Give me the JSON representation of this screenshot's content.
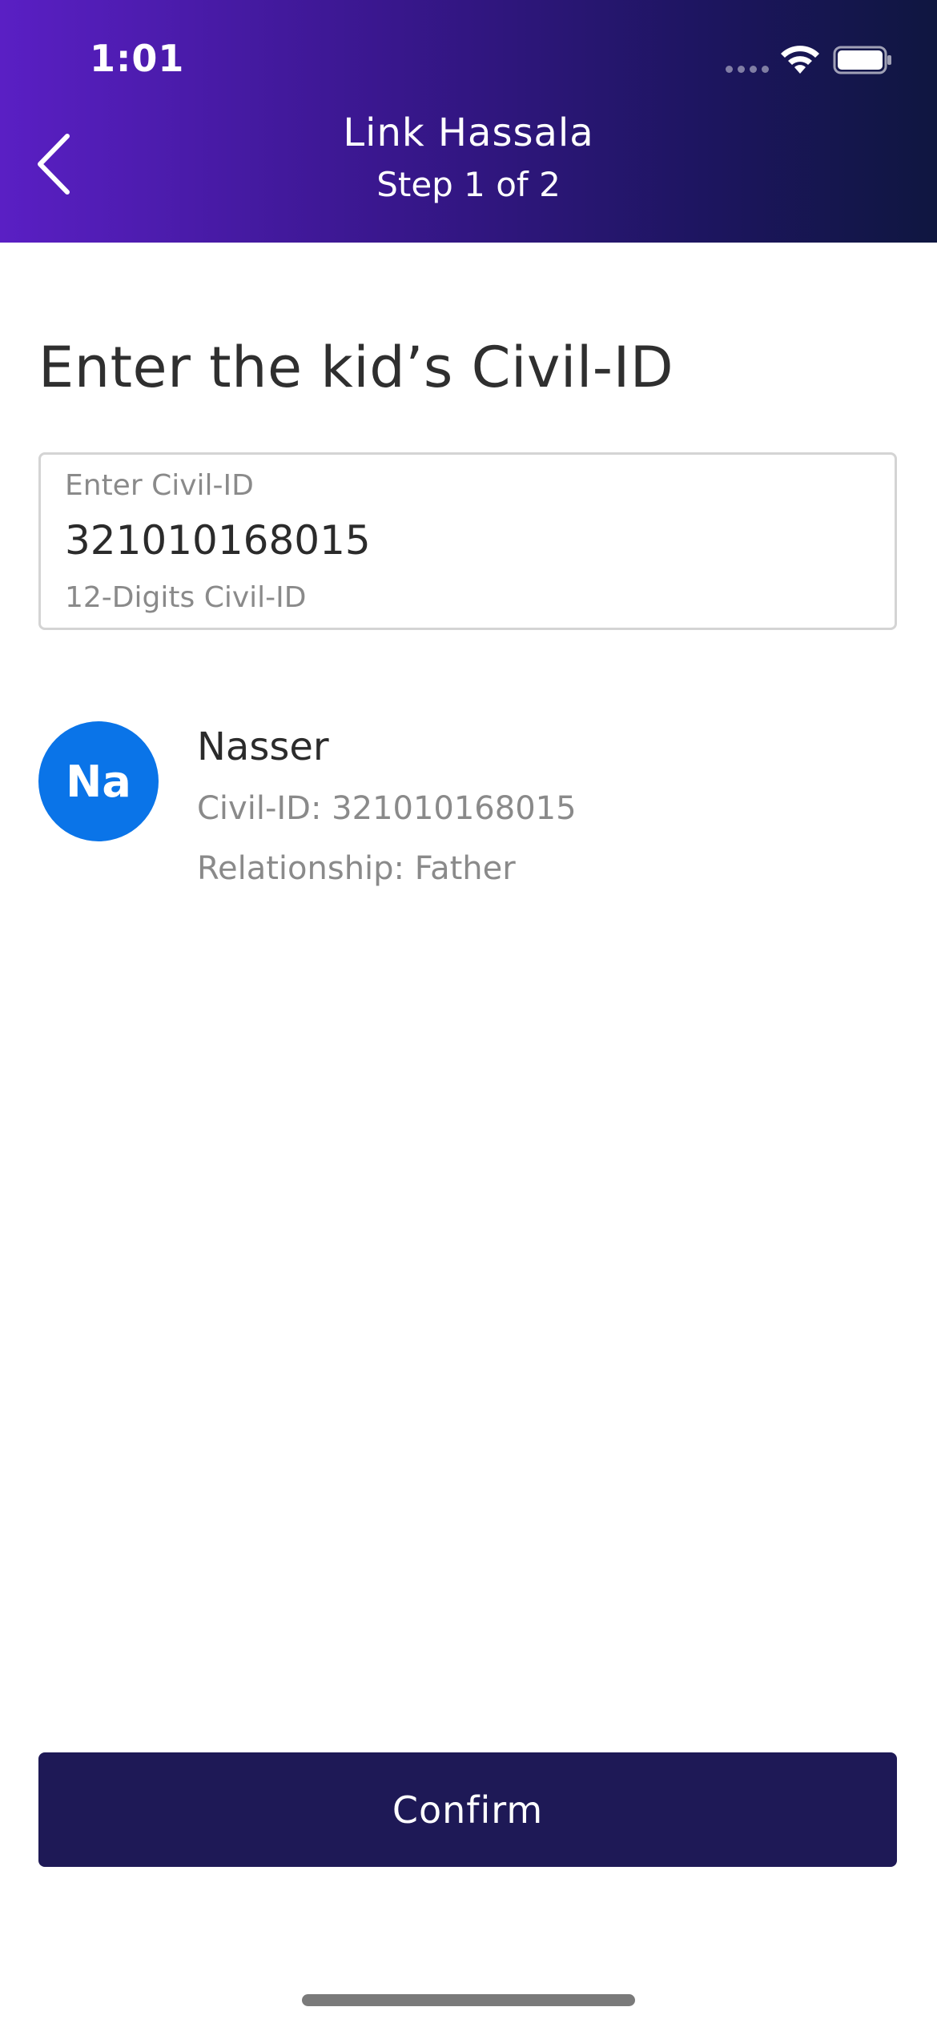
{
  "status_bar": {
    "time": "1:01"
  },
  "nav": {
    "title": "Link Hassala",
    "subtitle": "Step 1 of 2"
  },
  "page": {
    "title": "Enter the kid’s Civil-ID"
  },
  "civil_id_input": {
    "label": "Enter Civil-ID",
    "value": "321010168015",
    "hint": "12-Digits Civil-ID"
  },
  "person": {
    "initials": "Na",
    "name": "Nasser",
    "civil_id_line": "Civil-ID: 321010168015",
    "relationship_line": "Relationship: Father"
  },
  "actions": {
    "confirm_label": "Confirm"
  },
  "colors": {
    "header_gradient_start": "#5a1fc4",
    "header_gradient_end": "#0f1640",
    "avatar": "#0a74e8",
    "primary_button": "#1e1956"
  },
  "icons": {
    "back": "chevron-left-icon",
    "wifi": "wifi-icon",
    "battery": "battery-icon",
    "signal": "signal-dots-icon"
  }
}
